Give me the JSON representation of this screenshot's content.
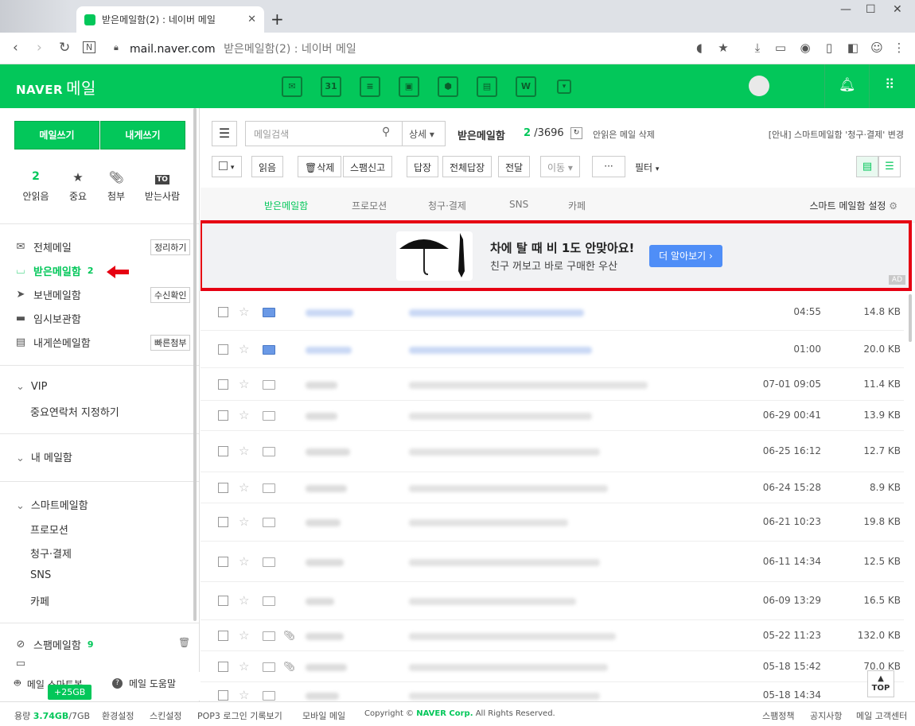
{
  "browser": {
    "tab_title": "받은메일함(2) : 네이버 메일",
    "url_host": "mail.naver.com",
    "url_path": "받은메일함(2) : 네이버 메일"
  },
  "header": {
    "logo": "NAVER",
    "logo_suffix": "메일"
  },
  "sidebar": {
    "write_button": "메일쓰기",
    "self_write_button": "내게쓰기",
    "quick": [
      {
        "value": "2",
        "label": "안읽음"
      },
      {
        "icon": "star-icon",
        "label": "중요"
      },
      {
        "icon": "clip-icon",
        "label": "첨부"
      },
      {
        "icon": "to-icon",
        "badge": "TO",
        "label": "받는사람"
      }
    ],
    "folders": [
      {
        "label": "전체메일",
        "action": "정리하기"
      },
      {
        "label": "받은메일함",
        "count": "2"
      },
      {
        "label": "보낸메일함",
        "action": "수신확인"
      },
      {
        "label": "임시보관함"
      },
      {
        "label": "내게쓴메일함",
        "action": "빠른첨부"
      }
    ],
    "vip_label": "VIP",
    "vip_sub": "중요연락처 지정하기",
    "my_mailbox": "내 메일함",
    "smart_label": "스마트메일함",
    "smart_items": [
      "프로모션",
      "청구·결제",
      "SNS",
      "카페"
    ],
    "spam_label": "스팸메일함",
    "spam_count": "9",
    "bot_label": "메일 스마트봇",
    "help_label": "메일 도움말",
    "plus_badge": "+25GB"
  },
  "toolbar": {
    "search_placeholder": "메일검색",
    "detail": "상세",
    "box_title": "받은메일함",
    "unread_count": "2",
    "total_count": "/3696",
    "delete_unread": "안읽은 메일 삭제",
    "notice": "[안내] 스마트메일함 '청구·결제' 변경",
    "buttons": [
      "읽음",
      "삭제",
      "스팸신고",
      "답장",
      "전체답장",
      "전달",
      "이동",
      "···"
    ],
    "filter": "필터"
  },
  "smart_tabs": {
    "tabs": [
      "받은메일함",
      "프로모션",
      "청구·결제",
      "SNS",
      "카페"
    ],
    "settings": "스마트 메일함 설정"
  },
  "ad": {
    "title": "차에 탈 때 비 1도 안맞아요!",
    "subtitle": "친구 꺼보고 바로 구매한 우산",
    "button": "더 알아보기 ›",
    "tag": "AD"
  },
  "mails": [
    {
      "date": "04:55",
      "size": "14.8 KB",
      "unread": true,
      "attach": false
    },
    {
      "date": "01:00",
      "size": "20.0 KB",
      "unread": true,
      "attach": false
    },
    {
      "date": "07-01 09:05",
      "size": "11.4 KB",
      "unread": false,
      "attach": false
    },
    {
      "date": "06-29 00:41",
      "size": "13.9 KB",
      "unread": false,
      "attach": false
    },
    {
      "date": "06-25 16:12",
      "size": "12.7 KB",
      "unread": false,
      "attach": false
    },
    {
      "date": "06-24 15:28",
      "size": "8.9 KB",
      "unread": false,
      "attach": false
    },
    {
      "date": "06-21 10:23",
      "size": "19.8 KB",
      "unread": false,
      "attach": false
    },
    {
      "date": "06-11 14:34",
      "size": "12.5 KB",
      "unread": false,
      "attach": false
    },
    {
      "date": "06-09 13:29",
      "size": "16.5 KB",
      "unread": false,
      "attach": false
    },
    {
      "date": "05-22 11:23",
      "size": "132.0 KB",
      "unread": false,
      "attach": true
    },
    {
      "date": "05-18 15:42",
      "size": "70.0 KB",
      "unread": false,
      "attach": true
    },
    {
      "date": "05-18 14:34",
      "size": "",
      "unread": false,
      "attach": false
    }
  ],
  "top_button": "TOP",
  "footer": {
    "usage_label": "용량",
    "usage_value": "3.74GB",
    "usage_total": "/7GB",
    "links": [
      "환경설정",
      "스킨설정",
      "POP3 로그인 기록보기",
      "모바일 메일"
    ],
    "copyright_pre": "Copyright ©",
    "copyright_corp": "NAVER Corp.",
    "copyright_post": "All Rights Reserved.",
    "right_links": [
      "스팸정책",
      "공지사항",
      "메일 고객센터"
    ]
  },
  "colors": {
    "brand": "#03c75a",
    "ad_border": "#e60012",
    "ad_button": "#4f8ef7"
  }
}
